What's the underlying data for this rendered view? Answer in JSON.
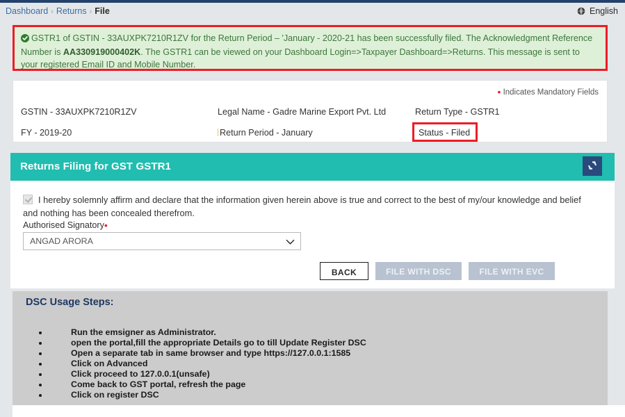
{
  "breadcrumb": {
    "items": [
      "Dashboard",
      "Returns",
      "File"
    ],
    "separator": "›"
  },
  "header": {
    "language": "English",
    "language_icon": "globe-icon"
  },
  "alert": {
    "icon": "check-circle-icon",
    "part1": "GSTR1 of GSTIN - 33AUXPK7210R1ZV for the Return Period – 'January - 2020-21 has been successfully filed. The Acknowledgment Reference Number is ",
    "arn": "AA330919000402K",
    "part2": ". The GSTR1 can be viewed on your Dashboard Login=>Taxpayer Dashboard=>Returns. This message is sent to your registered Email ID and Mobile Number.",
    "bg_color": "#dff0d8",
    "border_color": "#ee1c25"
  },
  "info": {
    "mandatory_note": "Indicates Mandatory Fields",
    "gstin": "GSTIN - 33AUXPK7210R1ZV",
    "legal_name": "Legal Name - Gadre Marine Export Pvt. Ltd",
    "return_type": "Return Type - GSTR1",
    "fy": "FY - 2019-20",
    "return_period": "Return Period -  January",
    "status": "Status - Filed",
    "status_highlight_color": "#ee1c25"
  },
  "panel": {
    "title": "Returns Filing for GST GSTR1",
    "accent_color": "#20bdb0",
    "refresh_icon": "refresh-icon"
  },
  "form": {
    "declaration": "I hereby solemnly affirm and declare that the information given herein above is true and correct to the best of my/our knowledge and belief and nothing has been concealed therefrom.",
    "checkbox_checked": true,
    "signatory_label": "Authorised Signatory",
    "signatory_value": "ANGAD ARORA",
    "signatory_options": [
      "ANGAD ARORA"
    ],
    "buttons": {
      "back": "BACK",
      "file_dsc": "FILE WITH DSC",
      "file_evc": "FILE WITH EVC"
    }
  },
  "dsc": {
    "title": "DSC Usage Steps:",
    "steps": [
      "Run the emsigner as Administrator.",
      "open the portal,fill the appropriate Details go to till Update Register DSC",
      "Open a separate tab in same browser and type https://127.0.0.1:1585",
      "Click on Advanced",
      "Click proceed to 127.0.0.1(unsafe)",
      "Come back to GST portal, refresh the page",
      "Click on register DSC"
    ]
  }
}
